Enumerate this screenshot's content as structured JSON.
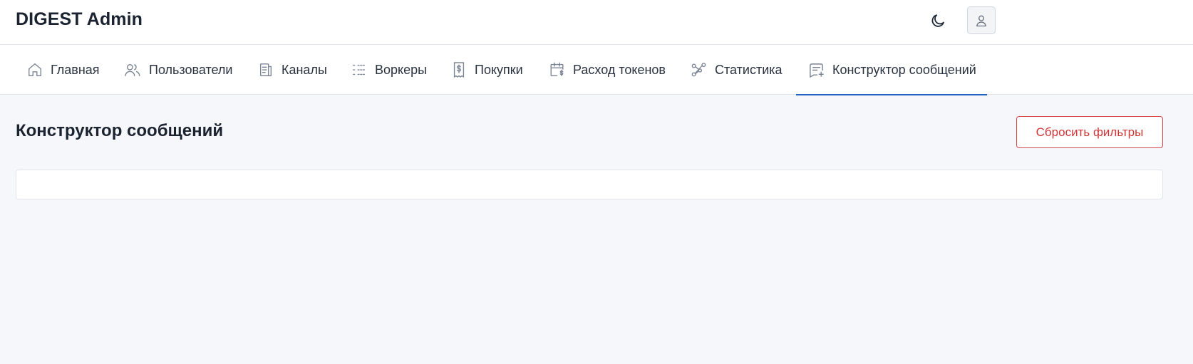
{
  "header": {
    "brand": "DIGEST Admin",
    "theme_icon": "moon-icon",
    "user_icon": "user-icon"
  },
  "nav": {
    "tabs": [
      {
        "label": "Главная",
        "icon": "home-icon",
        "active": false
      },
      {
        "label": "Пользователи",
        "icon": "users-icon",
        "active": false
      },
      {
        "label": "Каналы",
        "icon": "channels-icon",
        "active": false
      },
      {
        "label": "Воркеры",
        "icon": "list-icon",
        "active": false
      },
      {
        "label": "Покупки",
        "icon": "receipt-icon",
        "active": false
      },
      {
        "label": "Расход токенов",
        "icon": "calendar-dollar-icon",
        "active": false
      },
      {
        "label": "Статистика",
        "icon": "share-nodes-icon",
        "active": false
      },
      {
        "label": "Конструктор сообщений",
        "icon": "message-plus-icon",
        "active": true
      }
    ]
  },
  "main": {
    "title": "Конструктор сообщений",
    "reset_label": "Сбросить фильтры"
  },
  "colors": {
    "accent": "#1f5fbf",
    "danger": "#d03538",
    "background": "#f6f7fa"
  }
}
